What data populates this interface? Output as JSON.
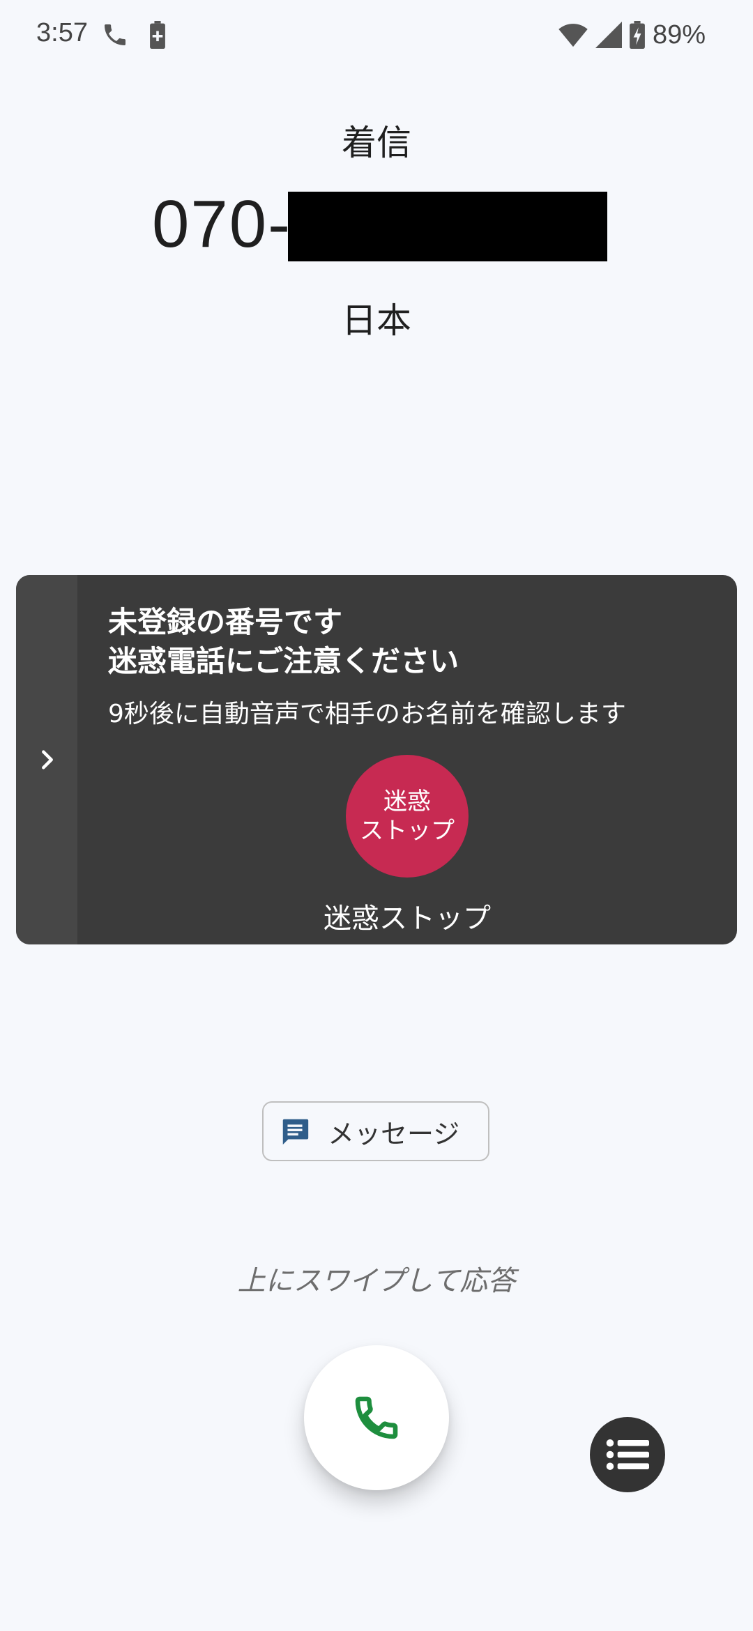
{
  "status_bar": {
    "time": "3:57",
    "battery_percent": "89%",
    "icons": [
      "phone-icon",
      "battery-saver-icon",
      "wifi-icon",
      "cell-signal-icon",
      "battery-charging-icon"
    ]
  },
  "call": {
    "label": "着信",
    "number_prefix": "070-",
    "country": "日本"
  },
  "spam_card": {
    "title_line1": "未登録の番号です",
    "title_line2": "迷惑電話にご注意ください",
    "description": "9秒後に自動音声で相手のお名前を確認します",
    "stop_button_line1": "迷惑",
    "stop_button_line2": "ストップ",
    "stop_caption": "迷惑ストップ",
    "stop_color": "#c72a52"
  },
  "message_button": {
    "label": "メッセージ",
    "icon": "message-icon"
  },
  "swipe_hint": "上にスワイプして応答",
  "answer_button": {
    "icon": "phone-answer-icon",
    "color": "#1e8e3e"
  },
  "menu_button": {
    "icon": "list-menu-icon"
  }
}
